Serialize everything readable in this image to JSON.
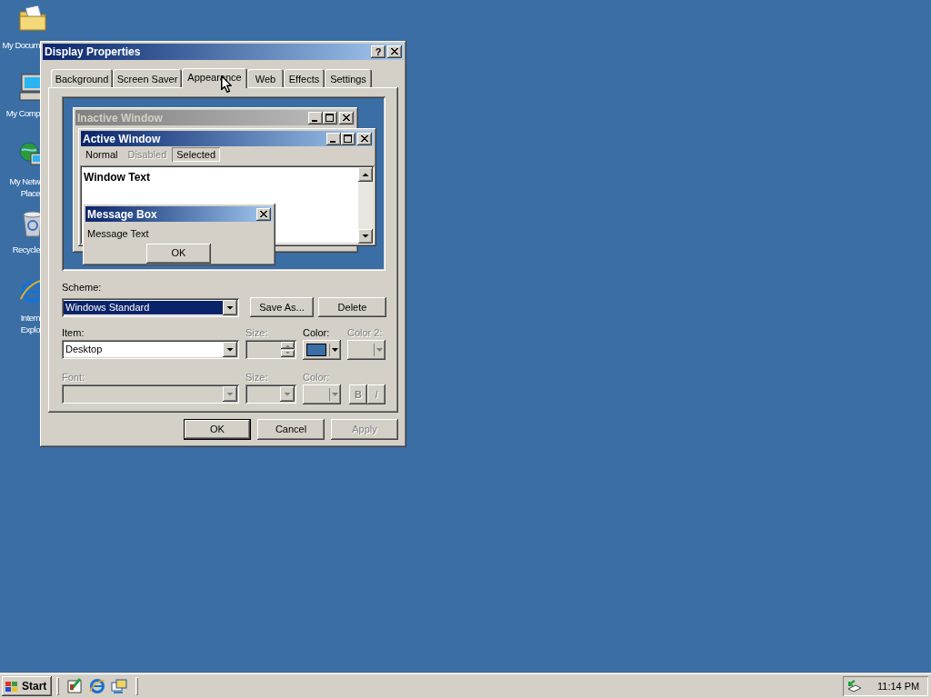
{
  "desktop_icons": [
    {
      "kind": "documents",
      "lines": [
        "My Docum"
      ]
    },
    {
      "kind": "computer",
      "lines": [
        "My Comp"
      ]
    },
    {
      "kind": "network",
      "lines": [
        "My Netw",
        "Place"
      ]
    },
    {
      "kind": "recycle",
      "lines": [
        "Recycle"
      ]
    },
    {
      "kind": "browser",
      "lines": [
        "Intern",
        "Explo"
      ]
    }
  ],
  "dialog": {
    "title": "Display Properties",
    "help": "?",
    "tabs": [
      {
        "label": "Background",
        "selected": false
      },
      {
        "label": "Screen Saver",
        "selected": false
      },
      {
        "label": "Appearance",
        "selected": true
      },
      {
        "label": "Web",
        "selected": false
      },
      {
        "label": "Effects",
        "selected": false
      },
      {
        "label": "Settings",
        "selected": false
      }
    ],
    "preview": {
      "inactive_window": {
        "title": "Inactive Window"
      },
      "active_window": {
        "title": "Active Window",
        "menu": [
          {
            "label": "Normal",
            "disabled": false,
            "selected": false
          },
          {
            "label": "Disabled",
            "disabled": true,
            "selected": false
          },
          {
            "label": "Selected",
            "disabled": false,
            "selected": true
          }
        ],
        "text": "Window Text"
      },
      "message_box": {
        "title": "Message Box",
        "text": "Message Text",
        "button": "OK"
      }
    },
    "scheme": {
      "label": "Scheme:",
      "value": "Windows Standard",
      "buttons": [
        {
          "label": "Save As..."
        },
        {
          "label": "Delete"
        }
      ]
    },
    "item_row": {
      "item": {
        "label": "Item:",
        "value": "Desktop",
        "disabled": false
      },
      "size": {
        "label": "Size:",
        "disabled": true
      },
      "color": {
        "label": "Color:",
        "disabled": false,
        "color": "#3a6ea5"
      },
      "color_2": {
        "label": "Color 2:",
        "disabled": true
      }
    },
    "font_row": {
      "font": {
        "label": "Font:",
        "disabled": true
      },
      "size": {
        "label": "Size:",
        "disabled": true
      },
      "color": {
        "label": "Color:",
        "disabled": true
      },
      "bold": {
        "label": "B",
        "disabled": true
      },
      "italic": {
        "label": "I",
        "disabled": true
      }
    },
    "buttons": [
      {
        "label": "OK",
        "default": true,
        "disabled": false
      },
      {
        "label": "Cancel",
        "default": false,
        "disabled": false
      },
      {
        "label": "Apply",
        "default": false,
        "disabled": true
      }
    ]
  },
  "taskbar": {
    "start": "Start",
    "quick_launch": [
      {
        "kind": "desktop"
      },
      {
        "kind": "browser"
      },
      {
        "kind": "channels"
      }
    ],
    "clock": "11:14 PM"
  }
}
